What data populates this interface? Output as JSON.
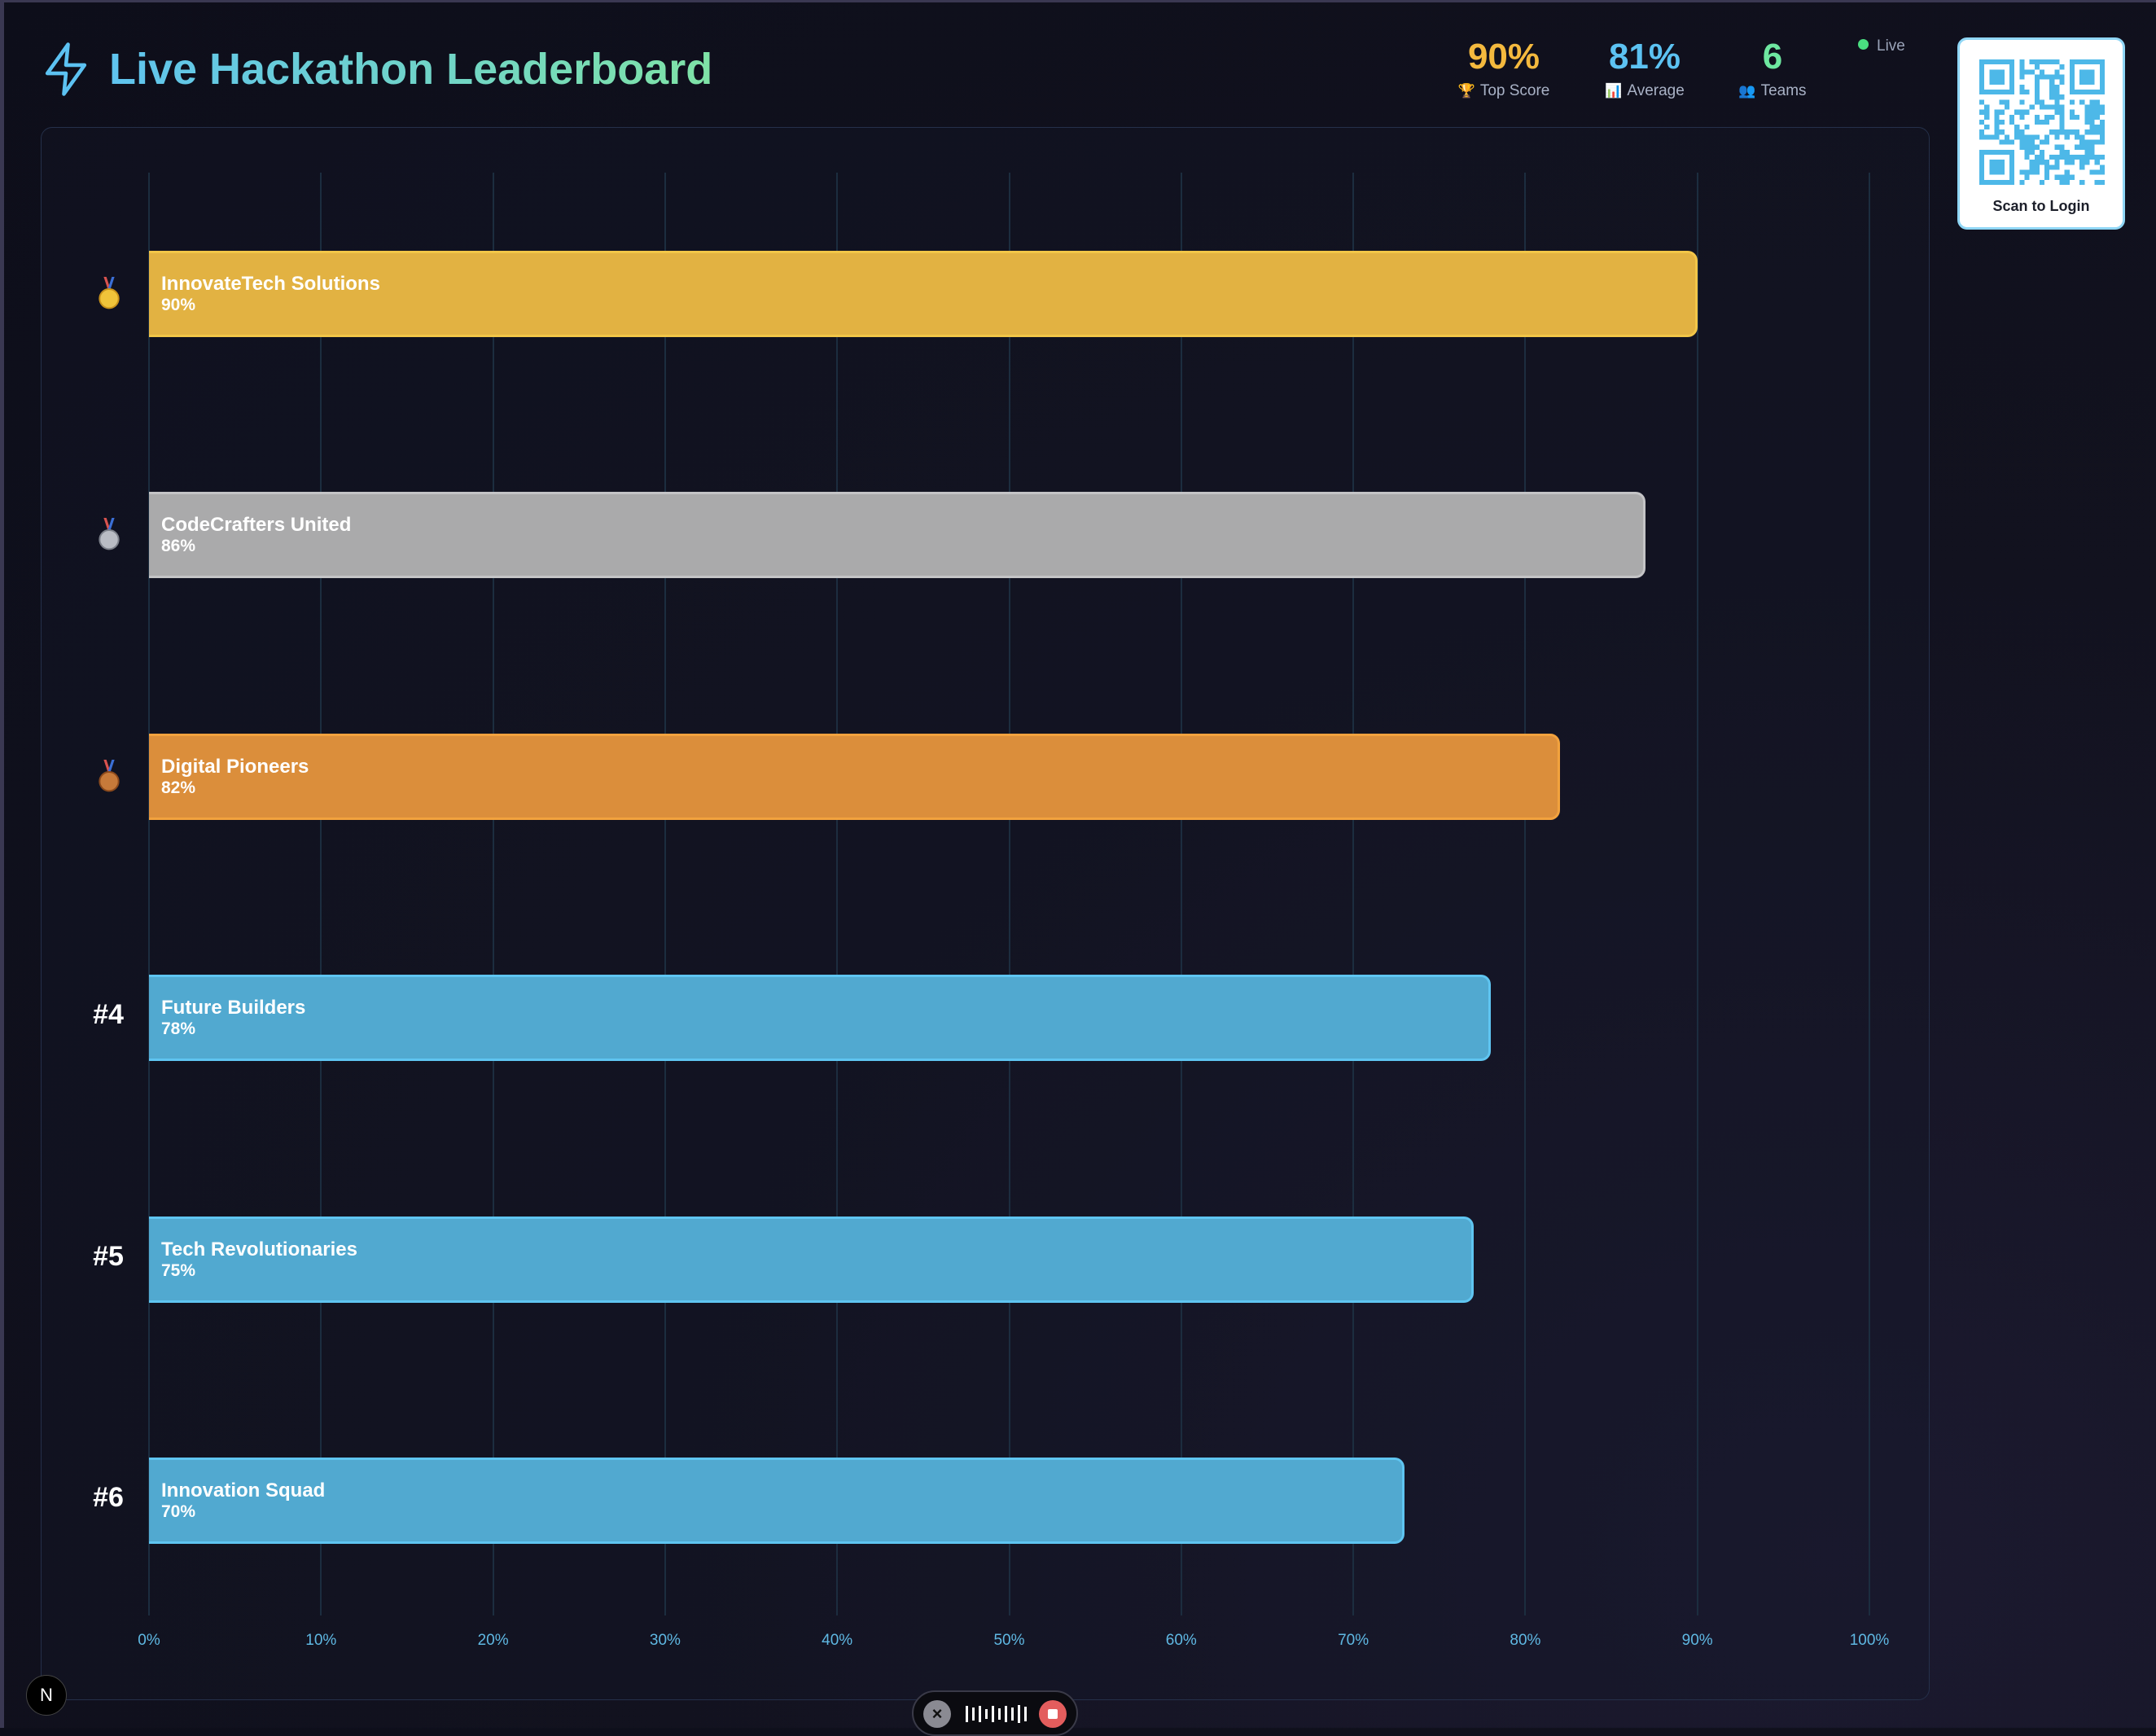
{
  "header": {
    "title": "Live Hackathon Leaderboard",
    "logo_icon": "lightning-bolt-icon",
    "stats": [
      {
        "value": "90%",
        "icon": "🏆",
        "label": "Top Score",
        "color": "#f4b93e"
      },
      {
        "value": "81%",
        "icon": "📊",
        "label": "Average",
        "color": "#5cc2f2"
      },
      {
        "value": "6",
        "icon": "👥",
        "label": "Teams",
        "color": "#6ee7a0"
      }
    ],
    "live_label": "Live"
  },
  "qr": {
    "caption": "Scan to Login"
  },
  "chart_data": {
    "type": "bar",
    "orientation": "horizontal",
    "xlim": [
      0,
      100
    ],
    "x_ticks": [
      "0%",
      "10%",
      "20%",
      "30%",
      "40%",
      "50%",
      "60%",
      "70%",
      "80%",
      "90%",
      "100%"
    ],
    "teams": [
      {
        "rank": 1,
        "rank_label": "🥇",
        "name": "InnovateTech Solutions",
        "value": 90,
        "value_label": "90%",
        "fill": "#e2b242",
        "border": "#f2c648"
      },
      {
        "rank": 2,
        "rank_label": "🥈",
        "name": "CodeCrafters United",
        "value": 87,
        "value_label": "86%",
        "fill": "#aaaaab",
        "border": "#c4c4c6"
      },
      {
        "rank": 3,
        "rank_label": "🥉",
        "name": "Digital Pioneers",
        "value": 82,
        "value_label": "82%",
        "fill": "#db8e3b",
        "border": "#f2a23e"
      },
      {
        "rank": 4,
        "rank_label": "#4",
        "name": "Future Builders",
        "value": 78,
        "value_label": "78%",
        "fill": "#51a9d0",
        "border": "#5fc5f1"
      },
      {
        "rank": 5,
        "rank_label": "#5",
        "name": "Tech Revolutionaries",
        "value": 77,
        "value_label": "75%",
        "fill": "#51a9d0",
        "border": "#5fc5f1"
      },
      {
        "rank": 6,
        "rank_label": "#6",
        "name": "Innovation Squad",
        "value": 73,
        "value_label": "70%",
        "fill": "#51a9d0",
        "border": "#5fc5f1"
      }
    ]
  },
  "footer": {
    "framework_badge": "N"
  }
}
